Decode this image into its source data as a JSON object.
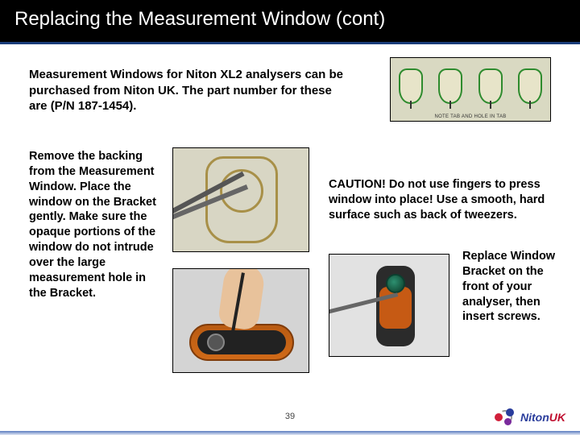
{
  "title": "Replacing the Measurement Window (cont)",
  "intro": "Measurement Windows for Niton XL2 analysers can be purchased from Niton UK. The part number for these are (P/N 187-1454).",
  "tabs_caption": "NOTE TAB AND HOLE IN TAB",
  "left_text": "Remove the backing from the Measurement Window. Place the window on the Bracket gently. Make sure the opaque portions of the window do not intrude over the large measurement hole in the Bracket.",
  "caution": "CAUTION! Do not use fingers to press window into place! Use a smooth, hard surface such as back of tweezers.",
  "final_text": "Replace Window Bracket on the front of your analyser, then insert screws.",
  "page_number": "39",
  "logo": {
    "brand": "Niton",
    "suffix": "UK"
  }
}
